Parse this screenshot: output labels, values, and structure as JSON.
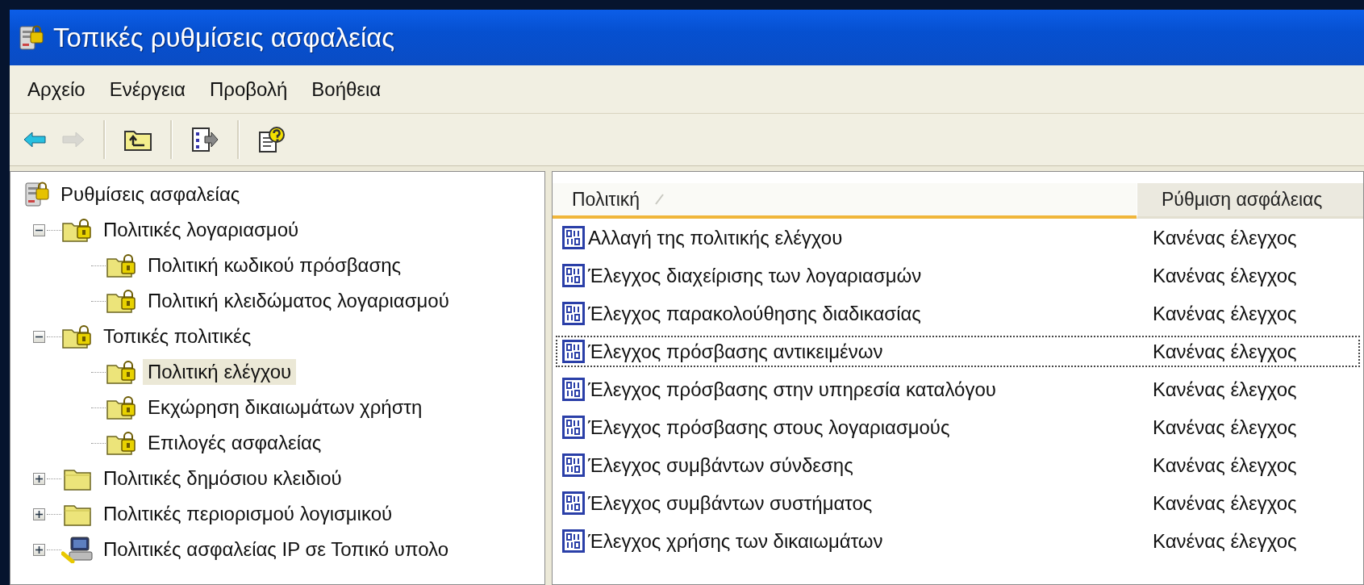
{
  "window": {
    "title": "Τοπικές ρυθμίσεις ασφαλείας"
  },
  "menu": [
    {
      "label": "Αρχείο"
    },
    {
      "label": "Ενέργεια"
    },
    {
      "label": "Προβολή"
    },
    {
      "label": "Βοήθεια"
    }
  ],
  "toolbar": [
    {
      "kind": "back",
      "disabled": false
    },
    {
      "kind": "forward",
      "disabled": true
    },
    {
      "kind": "separator"
    },
    {
      "kind": "up",
      "disabled": false
    },
    {
      "kind": "separator"
    },
    {
      "kind": "export",
      "disabled": false
    },
    {
      "kind": "separator"
    },
    {
      "kind": "help",
      "disabled": false
    }
  ],
  "tree": [
    {
      "label": "Ρυθμίσεις ασφαλείας",
      "kind": "server",
      "selected": false,
      "children": [
        {
          "label": "Πολιτικές λογαριασμού",
          "kind": "secure-folder",
          "expanded": true,
          "selected": false,
          "children": [
            {
              "label": "Πολιτική κωδικού πρόσβασης",
              "kind": "secure-folder",
              "selected": false
            },
            {
              "label": "Πολιτική κλειδώματος λογαριασμού",
              "kind": "secure-folder",
              "selected": false
            }
          ]
        },
        {
          "label": "Τοπικές πολιτικές",
          "kind": "secure-folder",
          "expanded": true,
          "selected": false,
          "children": [
            {
              "label": "Πολιτική ελέγχου",
              "kind": "secure-folder",
              "selected": true
            },
            {
              "label": "Εκχώρηση δικαιωμάτων χρήστη",
              "kind": "secure-folder",
              "selected": false
            },
            {
              "label": "Επιλογές ασφαλείας",
              "kind": "secure-folder",
              "selected": false
            }
          ]
        },
        {
          "label": "Πολιτικές δημόσιου κλειδιού",
          "kind": "folder",
          "expanded": false,
          "selected": false
        },
        {
          "label": "Πολιτικές περιορισμού λογισμικού",
          "kind": "folder",
          "expanded": false,
          "selected": false
        },
        {
          "label": "Πολιτικές ασφαλείας IP σε Τοπικό υπολο",
          "kind": "network",
          "expanded": false,
          "selected": false
        }
      ]
    }
  ],
  "list": {
    "columns": [
      {
        "label": "Πολιτική",
        "sorted": true,
        "hot": true
      },
      {
        "label": "Ρύθμιση ασφάλειας",
        "sorted": false,
        "hot": false
      }
    ],
    "rows": [
      {
        "policy": "Αλλαγή της πολιτικής ελέγχου",
        "setting": "Κανένας έλεγχος",
        "focused": false
      },
      {
        "policy": "Έλεγχος διαχείρισης των λογαριασμών",
        "setting": "Κανένας έλεγχος",
        "focused": false
      },
      {
        "policy": "Έλεγχος παρακολούθησης διαδικασίας",
        "setting": "Κανένας έλεγχος",
        "focused": false
      },
      {
        "policy": "Έλεγχος πρόσβασης αντικειμένων",
        "setting": "Κανένας έλεγχος",
        "focused": true
      },
      {
        "policy": "Έλεγχος πρόσβασης στην υπηρεσία καταλόγου",
        "setting": "Κανένας έλεγχος",
        "focused": false
      },
      {
        "policy": "Έλεγχος πρόσβασης στους λογαριασμούς",
        "setting": "Κανένας έλεγχος",
        "focused": false
      },
      {
        "policy": "Έλεγχος συμβάντων σύνδεσης",
        "setting": "Κανένας έλεγχος",
        "focused": false
      },
      {
        "policy": "Έλεγχος συμβάντων συστήματος",
        "setting": "Κανένας έλεγχος",
        "focused": false
      },
      {
        "policy": "Έλεγχος χρήσης των δικαιωμάτων",
        "setting": "Κανένας έλεγχος",
        "focused": false
      }
    ]
  }
}
